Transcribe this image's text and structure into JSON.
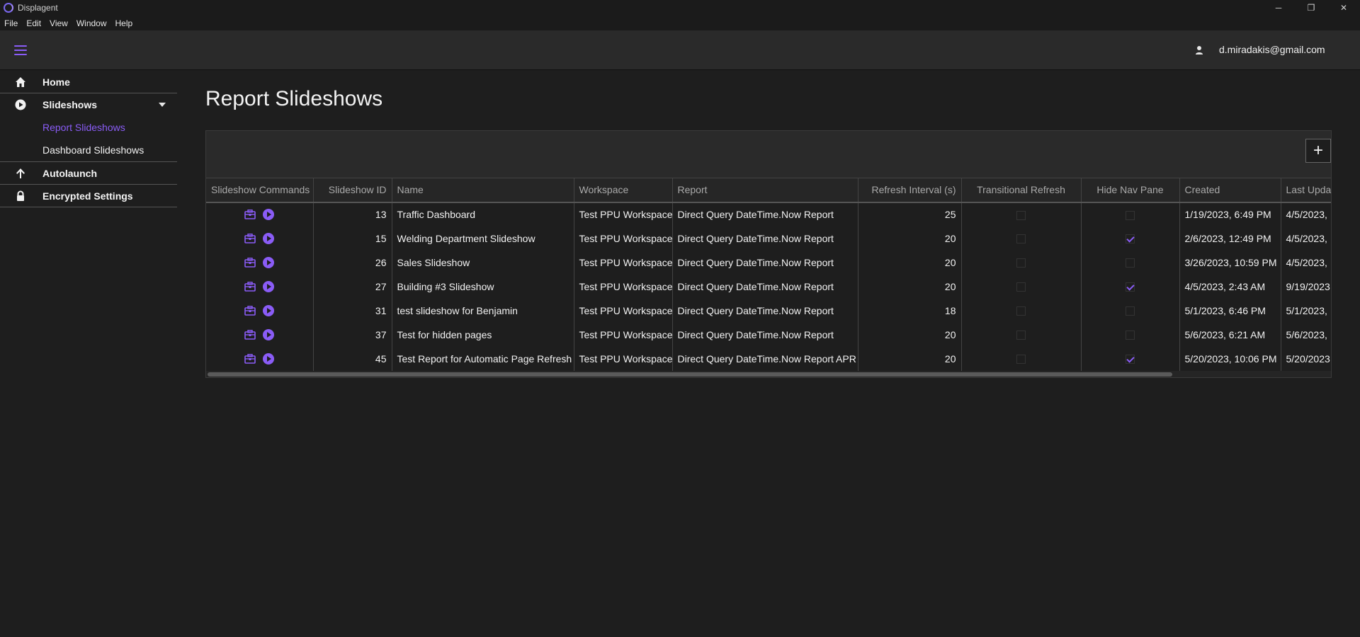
{
  "window": {
    "title": "Displagent",
    "controls": {
      "minimize": "─",
      "restore": "❐",
      "close": "✕"
    }
  },
  "menu": {
    "items": [
      "File",
      "Edit",
      "View",
      "Window",
      "Help"
    ]
  },
  "header": {
    "user_email": "d.miradakis@gmail.com"
  },
  "sidebar": {
    "home": "Home",
    "slideshows": "Slideshows",
    "report_slideshows": "Report Slideshows",
    "dashboard_slideshows": "Dashboard Slideshows",
    "autolaunch": "Autolaunch",
    "encrypted_settings": "Encrypted Settings"
  },
  "page": {
    "title": "Report Slideshows"
  },
  "grid": {
    "add_label": "+",
    "columns": {
      "commands": "Slideshow Commands",
      "id": "Slideshow ID",
      "name": "Name",
      "workspace": "Workspace",
      "report": "Report",
      "refresh": "Refresh Interval (s)",
      "transitional": "Transitional Refresh",
      "hide_nav": "Hide Nav Pane",
      "created": "Created",
      "last_updated": "Last Updat"
    },
    "rows": [
      {
        "id": "13",
        "name": "Traffic Dashboard",
        "workspace": "Test PPU Workspace",
        "report": "Direct Query DateTime.Now Report",
        "refresh": "25",
        "transitional": false,
        "hide_nav": false,
        "created": "1/19/2023, 6:49 PM",
        "last_updated": "4/5/2023,"
      },
      {
        "id": "15",
        "name": "Welding Department Slideshow",
        "workspace": "Test PPU Workspace",
        "report": "Direct Query DateTime.Now Report",
        "refresh": "20",
        "transitional": false,
        "hide_nav": true,
        "created": "2/6/2023, 12:49 PM",
        "last_updated": "4/5/2023,"
      },
      {
        "id": "26",
        "name": "Sales Slideshow",
        "workspace": "Test PPU Workspace",
        "report": "Direct Query DateTime.Now Report",
        "refresh": "20",
        "transitional": false,
        "hide_nav": false,
        "created": "3/26/2023, 10:59 PM",
        "last_updated": "4/5/2023,"
      },
      {
        "id": "27",
        "name": "Building #3 Slideshow",
        "workspace": "Test PPU Workspace",
        "report": "Direct Query DateTime.Now Report",
        "refresh": "20",
        "transitional": false,
        "hide_nav": true,
        "created": "4/5/2023, 2:43 AM",
        "last_updated": "9/19/2023"
      },
      {
        "id": "31",
        "name": "test slideshow for Benjamin",
        "workspace": "Test PPU Workspace",
        "report": "Direct Query DateTime.Now Report",
        "refresh": "18",
        "transitional": false,
        "hide_nav": false,
        "created": "5/1/2023, 6:46 PM",
        "last_updated": "5/1/2023,"
      },
      {
        "id": "37",
        "name": "Test for hidden pages",
        "workspace": "Test PPU Workspace",
        "report": "Direct Query DateTime.Now Report",
        "refresh": "20",
        "transitional": false,
        "hide_nav": false,
        "created": "5/6/2023, 6:21 AM",
        "last_updated": "5/6/2023,"
      },
      {
        "id": "45",
        "name": "Test Report for Automatic Page Refresh",
        "workspace": "Test PPU Workspace",
        "report": "Direct Query DateTime.Now Report APR",
        "refresh": "20",
        "transitional": false,
        "hide_nav": true,
        "created": "5/20/2023, 10:06 PM",
        "last_updated": "5/20/2023"
      }
    ]
  },
  "colors": {
    "accent": "#8a5cf6",
    "background": "#1e1e1e",
    "surface": "#2a2a2a"
  }
}
